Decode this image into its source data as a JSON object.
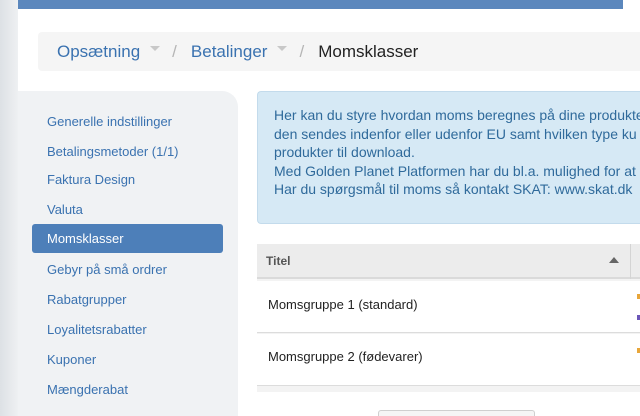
{
  "breadcrumb": {
    "items": [
      {
        "label": "Opsætning"
      },
      {
        "label": "Betalinger"
      },
      {
        "label": "Momsklasser"
      }
    ],
    "separator": "/"
  },
  "sidebar": {
    "items": [
      {
        "label": "Generelle indstillinger"
      },
      {
        "label": "Betalingsmetoder (1/1)"
      },
      {
        "label": "Faktura Design"
      },
      {
        "label": "Valuta"
      },
      {
        "label": "Momsklasser",
        "active": true
      },
      {
        "label": "Gebyr på små ordrer"
      },
      {
        "label": "Rabatgrupper"
      },
      {
        "label": "Loyalitetsrabatter"
      },
      {
        "label": "Kuponer"
      },
      {
        "label": "Mængderabat"
      }
    ]
  },
  "info": {
    "lines": [
      "Her kan du styre hvordan moms beregnes på dine produkter",
      "den sendes indenfor eller udenfor EU samt hvilken type ku",
      "produkter til download.",
      "Med Golden Planet Platformen har du bl.a. mulighed for at",
      "Har du spørgsmål til moms så kontakt SKAT: www.skat.dk"
    ]
  },
  "table": {
    "header": {
      "title": "Titel",
      "sort_icon": "sort-asc-icon"
    },
    "rows": [
      {
        "title": "Momsgruppe 1 (standard)"
      },
      {
        "title": "Momsgruppe 2 (fødevarer)"
      }
    ]
  },
  "colors": {
    "accent": "#4d7fb9",
    "link": "#3a72b0",
    "info_bg": "#d6e9f5",
    "info_text": "#2f6a9b"
  }
}
